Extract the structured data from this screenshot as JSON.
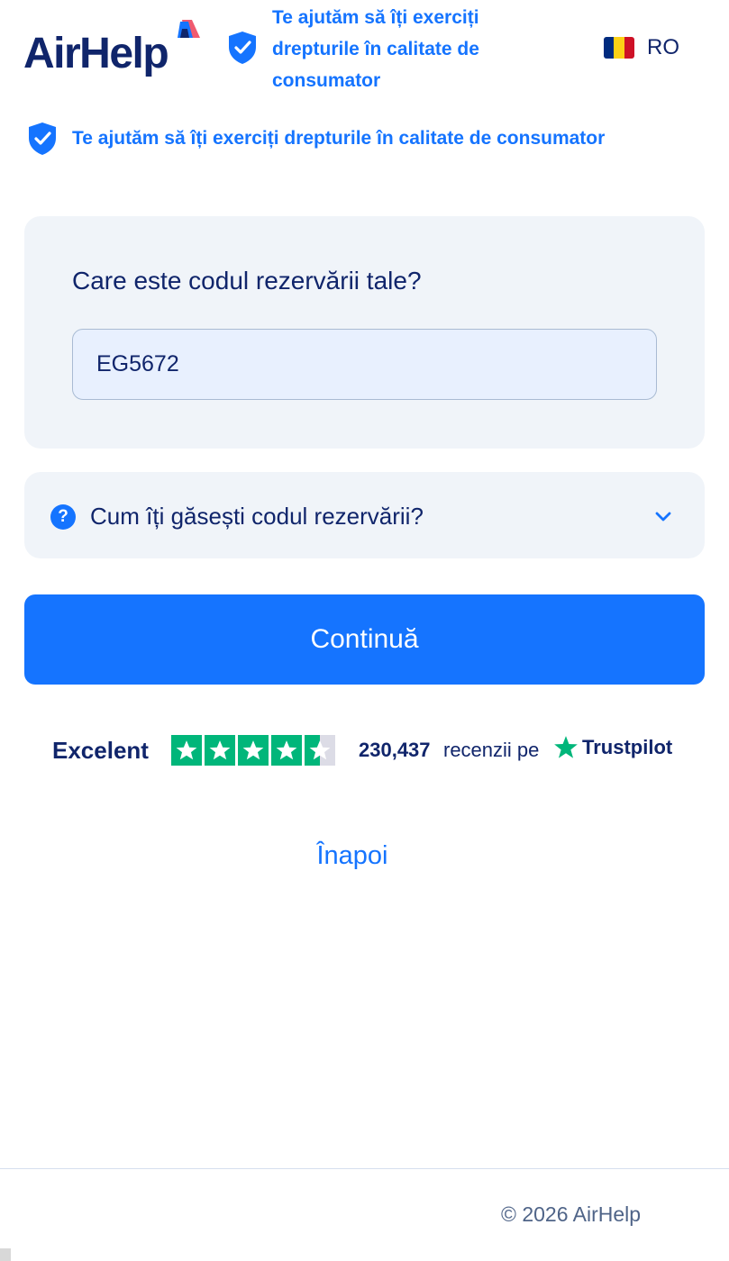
{
  "header": {
    "logo_text": "AirHelp",
    "tagline": "Te ajutăm să îți exerciți drepturile în calitate de consumator",
    "language_code": "RO",
    "flag_colors": [
      "#002b7f",
      "#fcd116",
      "#ce1126"
    ]
  },
  "trust_banner": {
    "text": "Te ajutăm să îți exerciți drepturile în calitate de consumator"
  },
  "booking_form": {
    "label": "Care este codul rezervării tale?",
    "input_value": "EG5672"
  },
  "help": {
    "question": "Cum îți găsești codul rezervării?",
    "icon": "question-icon",
    "expand_icon": "chevron-down-icon"
  },
  "continue_label": "Continuă",
  "trustpilot": {
    "rating_word": "Excelent",
    "stars": 4.5,
    "review_count": "230,437",
    "reviews_on": "recenzii pe",
    "brand": "Trustpilot",
    "star_color": "#00b67a"
  },
  "back_label": "Înapoi",
  "footer": {
    "copyright": "© 2026 AirHelp"
  },
  "colors": {
    "accent": "#1574ff",
    "navy": "#10256b",
    "card_bg": "#f0f4f9"
  }
}
